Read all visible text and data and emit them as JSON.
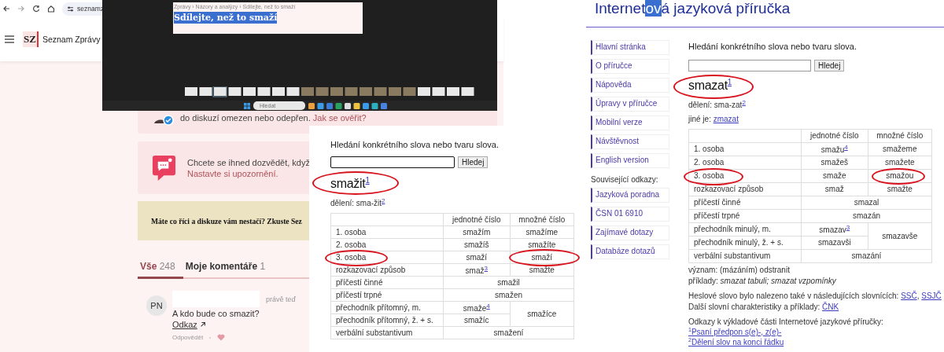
{
  "browser": {
    "url": "seznamz"
  },
  "site": {
    "logo": "SZ",
    "name": "Seznam Zprávy"
  },
  "notice_card": {
    "text": "do diskuzí omezen nebo odepřen.",
    "link": "Jak se ověřit?"
  },
  "alert_card": {
    "text": "Chcete se ihned dozvědět, když",
    "link": "Nastavte si upozornění."
  },
  "banner": {
    "text": "Máte co říci a diskuze vám nestačí? Zkuste Sez"
  },
  "tabs": [
    {
      "label": "Vše",
      "count": "248",
      "selected": true
    },
    {
      "label": "Moje komentáře",
      "count": "1",
      "selected": false
    }
  ],
  "comment": {
    "avatar": "PN",
    "time": "právě teď",
    "text": "A kdo bude co smazit?",
    "link": "Odkaz",
    "reply": "Odpovědět"
  },
  "screenshot": {
    "breadcrumb": "Zprávy › Názory a analýzy › Sdílejte, než to smaží",
    "title": "Sdílejte, než to smaží",
    "search_placeholder": "Hledat"
  },
  "dict_left": {
    "search_label": "Hledání konkrétního slova nebo tvaru slova.",
    "button": "Hledej",
    "headword": "smažit",
    "headword_ref": "1",
    "division": "dělení: sma-žit",
    "division_ref": "2",
    "columns": [
      "jednotné číslo",
      "množné číslo"
    ],
    "rows": [
      {
        "label": "1. osoba",
        "cells": [
          {
            "text": "smažím"
          },
          {
            "text": "smažíme"
          }
        ]
      },
      {
        "label": "2. osoba",
        "cells": [
          {
            "text": "smažíš"
          },
          {
            "text": "smažíte"
          }
        ]
      },
      {
        "label": "3. osoba",
        "cells": [
          {
            "text": "smaží"
          },
          {
            "text": "smaží"
          }
        ]
      },
      {
        "label": "rozkazovací způsob",
        "cells": [
          {
            "text": "smaž",
            "ref": "3"
          },
          {
            "text": "smažte"
          }
        ]
      },
      {
        "label": "příčestí činné",
        "cells": [
          {
            "text": "smažil",
            "colspan": 2
          }
        ]
      },
      {
        "label": "příčestí trpné",
        "cells": [
          {
            "text": "smažen",
            "colspan": 2
          }
        ]
      },
      {
        "label": "přechodník přítomný, m.",
        "cells": [
          {
            "text": "smaže",
            "ref": "4"
          },
          {
            "text": "smažíce",
            "rowspan": 2
          }
        ]
      },
      {
        "label": "přechodník přítomný, ž. + s.",
        "cells": [
          {
            "text": "smažíc"
          }
        ]
      },
      {
        "label": "verbální substantivum",
        "cells": [
          {
            "text": "smažení",
            "colspan": 2
          }
        ]
      }
    ]
  },
  "dict_right": {
    "title_parts": [
      {
        "text": "Internet",
        "selected": false
      },
      {
        "text": "ov",
        "selected": true
      },
      {
        "text": "á jazyková příručka",
        "selected": false
      }
    ],
    "sidebar": [
      {
        "label": "Hlavní stránka"
      },
      {
        "label": "O příručce"
      },
      {
        "label": "Nápověda"
      },
      {
        "label": "Úpravy v příručce"
      },
      {
        "label": "Mobilní verze"
      },
      {
        "label": "Návštěvnost"
      },
      {
        "label": "English version"
      }
    ],
    "related_label": "Související odkazy:",
    "related": [
      {
        "label": "Jazyková poradna"
      },
      {
        "label": "ČSN 01 6910"
      },
      {
        "label": "Zajímavé dotazy"
      },
      {
        "label": "Databáze dotazů"
      }
    ],
    "search_label": "Hledání konkrétního slova nebo tvaru slova.",
    "button": "Hledej",
    "headword": "smazat",
    "headword_ref": "1",
    "division": "dělení: sma-zat",
    "division_ref": "2",
    "other": "jiné je:",
    "other_link": "zmazat",
    "columns": [
      "jednotné číslo",
      "množné číslo"
    ],
    "rows": [
      {
        "label": "1. osoba",
        "cells": [
          {
            "text": "smažu",
            "ref": "4"
          },
          {
            "text": "smažeme"
          }
        ]
      },
      {
        "label": "2. osoba",
        "cells": [
          {
            "text": "smažeš"
          },
          {
            "text": "smažete"
          }
        ]
      },
      {
        "label": "3. osoba",
        "cells": [
          {
            "text": "smaže"
          },
          {
            "text": "smažou"
          }
        ]
      },
      {
        "label": "rozkazovací způsob",
        "cells": [
          {
            "text": "smaž"
          },
          {
            "text": "smažte"
          }
        ]
      },
      {
        "label": "příčestí činné",
        "cells": [
          {
            "text": "smazal",
            "colspan": 2
          }
        ]
      },
      {
        "label": "příčestí trpné",
        "cells": [
          {
            "text": "smazán",
            "colspan": 2
          }
        ]
      },
      {
        "label": "přechodník minulý, m.",
        "cells": [
          {
            "text": "smazav",
            "ref": "3"
          },
          {
            "text": "smazavše",
            "rowspan": 2
          }
        ]
      },
      {
        "label": "přechodník minulý, ž. + s.",
        "cells": [
          {
            "text": "smazavši"
          }
        ]
      },
      {
        "label": "verbální substantivum",
        "cells": [
          {
            "text": "smazání",
            "colspan": 2
          }
        ]
      }
    ],
    "meaning": "význam: (mázáním) odstranit",
    "examples": "příklady: *smazat tabuli; smazat vzpomínky*",
    "found": {
      "text": "Heslové slovo bylo nalezeno také v následujících slovnících:",
      "links": [
        "SSČ",
        "SSJČ"
      ],
      "separator": ","
    },
    "more": {
      "text": "Další slovní charakteristiky a příklady:",
      "link": "ČNK"
    },
    "refs_label": "Odkazy k výkladové části Internetové jazykové příručky:",
    "refs": [
      {
        "num": "1",
        "text": "Psaní předpon s(e)-, z(e)-"
      },
      {
        "num": "2",
        "text": "Dělení slov na konci řádku"
      }
    ]
  }
}
